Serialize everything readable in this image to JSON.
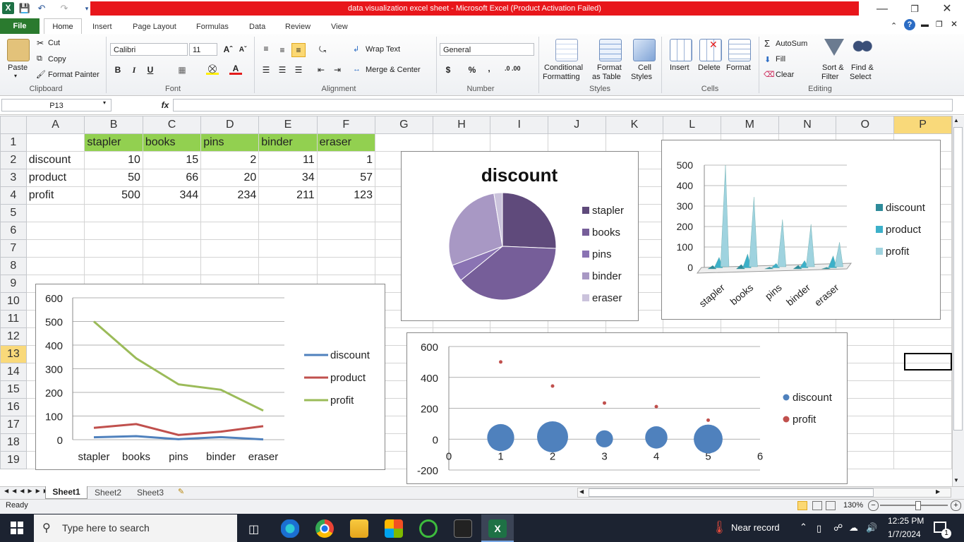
{
  "window": {
    "title": "data visualization excel sheet  -  Microsoft Excel (Product Activation Failed)",
    "app_icon": "X",
    "title_bg": "#e8161b"
  },
  "ribbon_tabs": [
    "File",
    "Home",
    "Insert",
    "Page Layout",
    "Formulas",
    "Data",
    "Review",
    "View"
  ],
  "ribbon": {
    "clipboard": {
      "paste": "Paste",
      "cut": "Cut",
      "copy": "Copy",
      "format_painter": "Format Painter",
      "label": "Clipboard"
    },
    "font": {
      "name": "Calibri",
      "size": "11",
      "bold": "B",
      "italic": "I",
      "underline": "U",
      "label": "Font"
    },
    "alignment": {
      "wrap": "Wrap Text",
      "merge": "Merge & Center",
      "label": "Alignment"
    },
    "number": {
      "format": "General",
      "currency": "$",
      "percent": "%",
      "comma": ",",
      "inc": ".0 .00",
      "label": "Number"
    },
    "styles": {
      "conditional": "Conditional",
      "conditional2": "Formatting",
      "format_table": "Format",
      "format_table2": "as Table",
      "cell_styles": "Cell",
      "cell_styles2": "Styles",
      "label": "Styles"
    },
    "cells": {
      "insert": "Insert",
      "delete": "Delete",
      "format": "Format",
      "label": "Cells"
    },
    "editing": {
      "autosum": "AutoSum",
      "fill": "Fill",
      "clear": "Clear",
      "sort": "Sort &",
      "sort2": "Filter",
      "find": "Find &",
      "find2": "Select",
      "label": "Editing"
    }
  },
  "formula_bar": {
    "name_box": "P13",
    "fx": "fx",
    "value": ""
  },
  "columns": [
    "A",
    "B",
    "C",
    "D",
    "E",
    "F",
    "G",
    "H",
    "I",
    "J",
    "K",
    "L",
    "M",
    "N",
    "O",
    "P"
  ],
  "rows": [
    "1",
    "2",
    "3",
    "4",
    "5",
    "6",
    "7",
    "8",
    "9",
    "10",
    "11",
    "12",
    "13",
    "14",
    "15",
    "16",
    "17",
    "18",
    "19"
  ],
  "cells": {
    "header": [
      "",
      "stapler",
      "books",
      "pins",
      "binder",
      "eraser"
    ],
    "discount": [
      "discount",
      "10",
      "15",
      "2",
      "11",
      "1"
    ],
    "product": [
      "product",
      "50",
      "66",
      "20",
      "34",
      "57"
    ],
    "profit": [
      "profit",
      "500",
      "344",
      "234",
      "211",
      "123"
    ]
  },
  "chart_data": [
    {
      "type": "pie",
      "title": "discount",
      "categories": [
        "stapler",
        "books",
        "pins",
        "binder",
        "eraser"
      ],
      "values": [
        10,
        15,
        2,
        11,
        1
      ],
      "colors": [
        "#5f4a7b",
        "#765e99",
        "#8a73b3",
        "#a898c4",
        "#cbc3dc"
      ],
      "legend": "right"
    },
    {
      "type": "bar",
      "variant": "3d-cone",
      "categories": [
        "stapler",
        "books",
        "pins",
        "binder",
        "eraser"
      ],
      "series": [
        {
          "name": "discount",
          "values": [
            10,
            15,
            2,
            11,
            1
          ],
          "color": "#2e8b9a"
        },
        {
          "name": "product",
          "values": [
            50,
            66,
            20,
            34,
            57
          ],
          "color": "#3cb0c9"
        },
        {
          "name": "profit",
          "values": [
            500,
            344,
            234,
            211,
            123
          ],
          "color": "#9fd3df"
        }
      ],
      "ylim": [
        0,
        500
      ],
      "yticks": [
        "0",
        "100",
        "200",
        "300",
        "400",
        "500"
      ],
      "legend": "right"
    },
    {
      "type": "line",
      "categories": [
        "stapler",
        "books",
        "pins",
        "binder",
        "eraser"
      ],
      "series": [
        {
          "name": "discount",
          "values": [
            10,
            15,
            2,
            11,
            1
          ],
          "color": "#4f81bd"
        },
        {
          "name": "product",
          "values": [
            50,
            66,
            20,
            34,
            57
          ],
          "color": "#c0504d"
        },
        {
          "name": "profit",
          "values": [
            500,
            344,
            234,
            211,
            123
          ],
          "color": "#9bbb59"
        }
      ],
      "ylim": [
        0,
        600
      ],
      "yticks": [
        "0",
        "100",
        "200",
        "300",
        "400",
        "500",
        "600"
      ],
      "legend": "right"
    },
    {
      "type": "scatter",
      "variant": "bubble",
      "x": [
        1,
        2,
        3,
        4,
        5
      ],
      "series": [
        {
          "name": "discount",
          "values": [
            10,
            15,
            2,
            11,
            1
          ],
          "sizes": [
            50,
            66,
            20,
            34,
            57
          ],
          "color": "#4f81bd"
        },
        {
          "name": "profit",
          "values": [
            500,
            344,
            234,
            211,
            123
          ],
          "color": "#c0504d"
        }
      ],
      "xlim": [
        0,
        6
      ],
      "xticks": [
        "0",
        "1",
        "2",
        "3",
        "4",
        "5",
        "6"
      ],
      "ylim": [
        -200,
        600
      ],
      "yticks": [
        "-200",
        "0",
        "200",
        "400",
        "600"
      ],
      "legend": "right"
    }
  ],
  "sheet_tabs": [
    "Sheet1",
    "Sheet2",
    "Sheet3"
  ],
  "status": {
    "ready": "Ready",
    "zoom": "130%"
  },
  "taskbar": {
    "search_placeholder": "Type here to search",
    "weather": "Near record",
    "time": "12:25 PM",
    "date": "1/7/2024",
    "notif_count": "1"
  }
}
